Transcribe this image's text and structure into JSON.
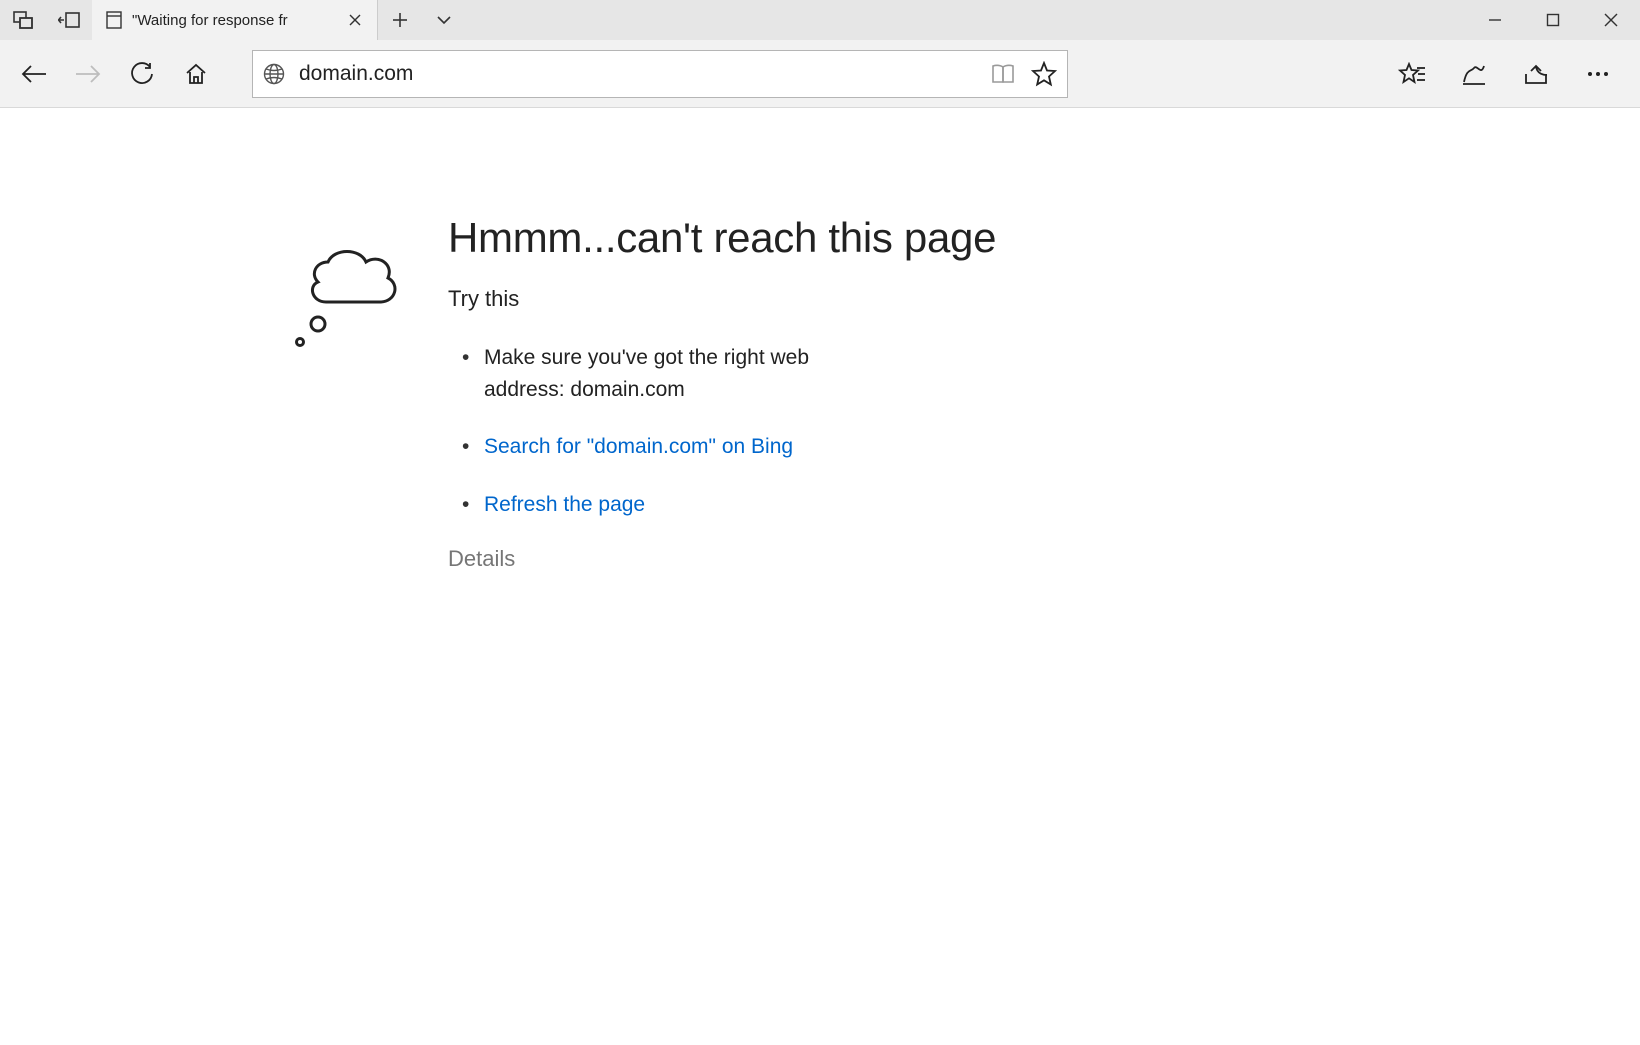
{
  "tab": {
    "title": "\"Waiting for response fr"
  },
  "address": {
    "url": "domain.com"
  },
  "error": {
    "title": "Hmmm...can't reach this page",
    "try_this": "Try this",
    "suggestion_prefix": "Make sure you've got the right web address: ",
    "suggestion_domain": "domain.com",
    "search_link": "Search for \"domain.com\" on Bing",
    "refresh_link": "Refresh the page",
    "details": "Details"
  }
}
